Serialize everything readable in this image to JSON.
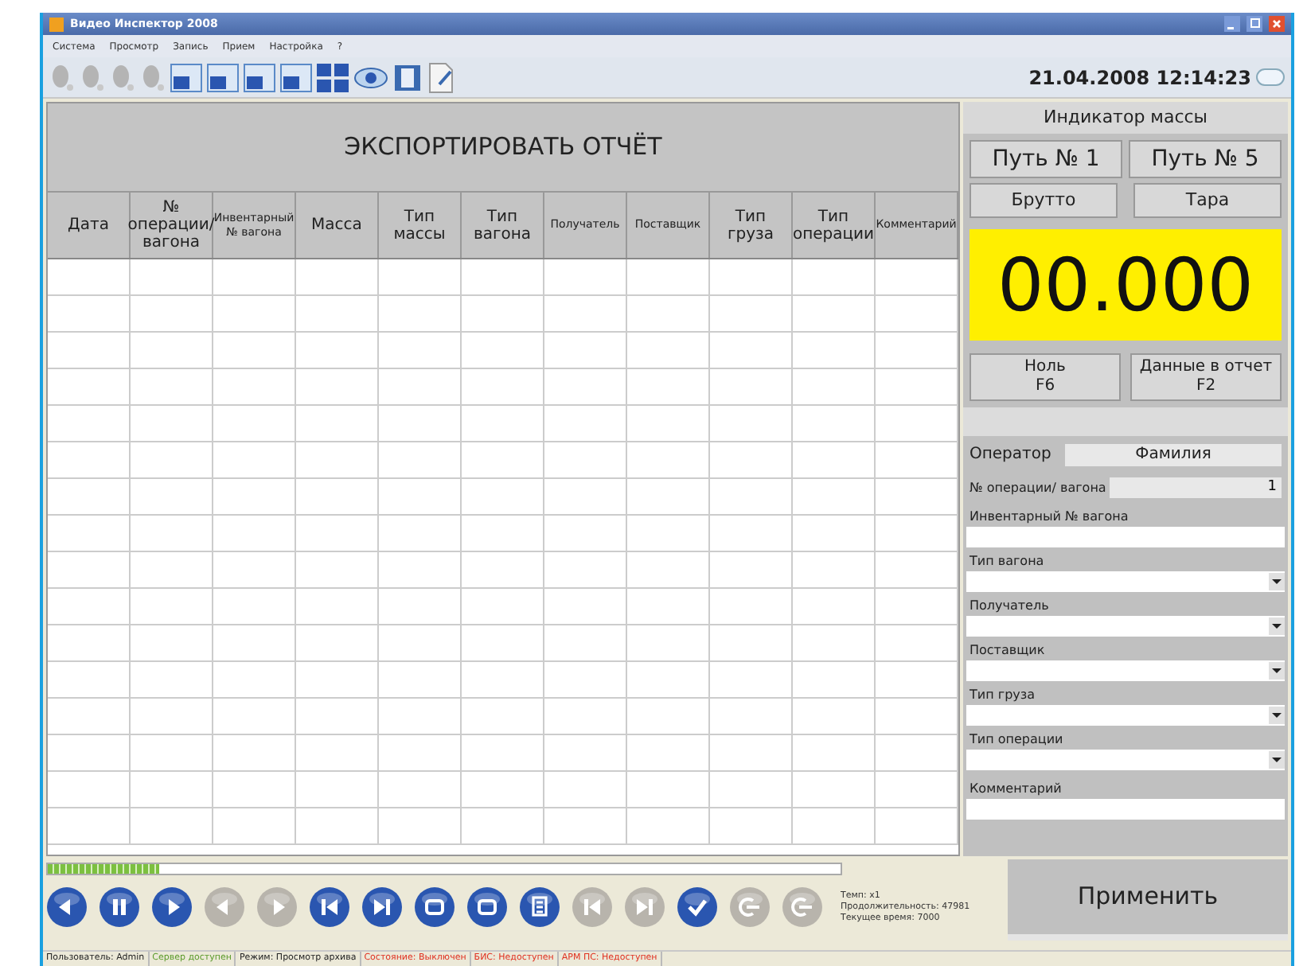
{
  "window": {
    "title": "Видео Инспектор 2008"
  },
  "menu": [
    "Система",
    "Просмотр",
    "Запись",
    "Прием",
    "Настройка",
    "?"
  ],
  "datetime": "21.04.2008 12:14:23",
  "report": {
    "title": "ЭКСПОРТИРОВАТЬ ОТЧЁТ",
    "columns": [
      {
        "label": "Дата",
        "kind": "large"
      },
      {
        "label": "№ операции/ вагона",
        "kind": "large"
      },
      {
        "label": "Инвентарный № вагона",
        "kind": "small"
      },
      {
        "label": "Масса",
        "kind": "large"
      },
      {
        "label": "Тип массы",
        "kind": "large"
      },
      {
        "label": "Тип вагона",
        "kind": "large"
      },
      {
        "label": "Получатель",
        "kind": "small"
      },
      {
        "label": "Поставщик",
        "kind": "small"
      },
      {
        "label": "Тип груза",
        "kind": "large"
      },
      {
        "label": "Тип операции",
        "kind": "large"
      },
      {
        "label": "Комментарий",
        "kind": "small"
      }
    ]
  },
  "scale": {
    "title": "Индикатор массы",
    "tracks": [
      {
        "label": "Путь № 1"
      },
      {
        "label": "Путь № 5"
      }
    ],
    "modes": [
      {
        "label": "Брутто"
      },
      {
        "label": "Тара"
      }
    ],
    "reading": "00.000",
    "actions": [
      {
        "label": "Ноль",
        "key": "F6"
      },
      {
        "label": "Данные в отчет",
        "key": "F2"
      }
    ]
  },
  "form": {
    "operator_label": "Оператор",
    "operator": "Фамилия",
    "fields": [
      {
        "kind": "counter",
        "label": "№ операции/ вагона",
        "value": "1"
      },
      {
        "kind": "text",
        "label": "Инвентарный № вагона"
      },
      {
        "kind": "select",
        "label": "Тип вагона"
      },
      {
        "kind": "select",
        "label": "Получатель"
      },
      {
        "kind": "select",
        "label": "Поставщик"
      },
      {
        "kind": "select",
        "label": "Тип груза"
      },
      {
        "kind": "select",
        "label": "Тип операции"
      },
      {
        "kind": "text",
        "label": "Комментарий"
      }
    ],
    "apply": "Применить"
  },
  "playback": {
    "level": 0.14,
    "buttons": [
      {
        "kind": "prev",
        "disabled": false
      },
      {
        "kind": "pause",
        "disabled": false
      },
      {
        "kind": "play",
        "disabled": false
      },
      {
        "kind": "prev",
        "disabled": true
      },
      {
        "kind": "play",
        "disabled": true
      },
      {
        "kind": "start",
        "disabled": false
      },
      {
        "kind": "end",
        "disabled": false
      },
      {
        "kind": "cam",
        "disabled": false
      },
      {
        "kind": "cam",
        "disabled": false
      },
      {
        "kind": "doc",
        "disabled": false
      },
      {
        "kind": "start",
        "disabled": true
      },
      {
        "kind": "end",
        "disabled": true
      },
      {
        "kind": "check",
        "disabled": false
      },
      {
        "kind": "exit",
        "disabled": true
      },
      {
        "kind": "exit",
        "disabled": true
      }
    ],
    "info": [
      "Темп: x1",
      "Продолжительность: 47981",
      "Текущее время: 7000"
    ]
  },
  "status_bar": [
    {
      "text": "Пользователь: Admin",
      "color": "#222222"
    },
    {
      "text": "Сервер доступен",
      "color": "#5a9a2a"
    },
    {
      "text": "Режим: Просмотр архива",
      "color": "#222222"
    },
    {
      "text": "Состояние: Выключен",
      "color": "#e03020"
    },
    {
      "text": "БИС: Недоступен",
      "color": "#e03020"
    },
    {
      "text": "АРМ ПС: Недоступен",
      "color": "#e03020"
    }
  ]
}
